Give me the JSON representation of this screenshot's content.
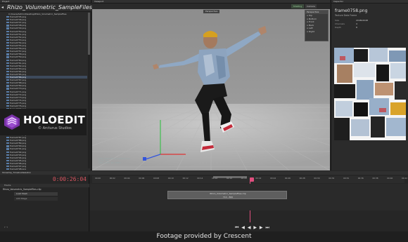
{
  "project": {
    "panel_title": "Project",
    "root_title": "Rhizo_Volumetric_SampleFiles",
    "path": "C:/Users/Admin/Desktop/Rhizo_Volumetric_SampleFiles",
    "files": [
      "frame0745.png",
      "frame0746.png",
      "frame0747.png",
      "frame0748.png",
      "frame0749.png",
      "frame0750.png",
      "frame0751.png",
      "frame0752.png",
      "frame0753.png",
      "frame0754.png",
      "frame0755.png",
      "frame0756.png",
      "frame0757.png",
      "frame0758.png",
      "frame0759.png",
      "frame0760.png",
      "frame0761.png",
      "frame0762.png",
      "frame0763.png",
      "frame0764.png",
      "frame0765.png",
      "frame0766.png",
      "frame0767.png",
      "frame0768.png",
      "frame0769.png",
      "frame0770.png",
      "frame0771.png",
      "frame0772.png",
      "frame0773.png",
      "frame0774.png",
      "frame0775.png",
      "frame0776.png",
      "frame0777.png",
      "frame0778.png",
      "frame0779.png",
      "frame0780.png",
      "frame0781.png",
      "frame0782.png",
      "frame0783.png",
      "frame0784.png",
      "frame0785.png",
      "frame0786.png",
      "frame0787.png",
      "frame0788.png",
      "frame0789.png",
      "frame0790.png",
      "frame0791.png",
      "frame0792.png",
      "frame0793.png",
      "frame0794.png",
      "frame0795.png",
      "frame0796.png",
      "frame0797.png",
      "frame0798.png"
    ],
    "selected_index": 21
  },
  "logo": {
    "title": "HOLOEDIT",
    "subtitle": "© Arcturus Studios"
  },
  "viewport": {
    "panel_title": "Viewport",
    "tab_label": "Perspective",
    "render_label": "Shading",
    "camera_label": "Camera",
    "persp_menu": {
      "header": "Perspective",
      "items": [
        "Top",
        "Bottom",
        "Front",
        "Back",
        "Left",
        "Right"
      ]
    },
    "info_lines": [
      "Rhizo_Volumetric_SampleFiles.clip",
      "Frame: 758",
      "Verts: 21431  Tris: 40000"
    ]
  },
  "inspector": {
    "panel_title": "Inspector",
    "file_name": "frame0758.png",
    "subtitle": "Texture Data Frame",
    "rows": [
      {
        "label": "Size",
        "value": "2048x2048"
      },
      {
        "label": "Channels",
        "value": "4"
      },
      {
        "label": "Depth",
        "value": "8"
      }
    ]
  },
  "timeline": {
    "panel_title": "ShowClip_TimelineSkeleton",
    "timecode": "0:00:26:04",
    "tracks_header": "Tracks",
    "clip_row": "Rhizo_Volumetric_SampleFiles.clip",
    "sub_item_1": "Load Mesh",
    "sub_item_2": "Add Stage",
    "ruler_ticks": [
      "00:00",
      "00:02",
      "00:04",
      "00:06",
      "00:08",
      "00:10",
      "00:12",
      "00:14",
      "00:16",
      "00:18",
      "00:20",
      "00:22",
      "00:24",
      "00:26",
      "00:28",
      "00:30",
      "00:32",
      "00:34",
      "00:36",
      "00:38",
      "00:40",
      "00:42"
    ],
    "clip_label": "Rhizo_Volumetric_SampleFiles.clip",
    "clip_range": "710 - 800",
    "tool_label": "⊢⊣",
    "controls": "⏮ ◀ ◀ ▶ ▶ ⏭"
  },
  "footer": {
    "text": "Footage provided by Crescent"
  },
  "colors": {
    "accent_pink": "#e04f7e",
    "timecode_red": "#d6545f",
    "logo_purple": "#8a3fb8"
  }
}
